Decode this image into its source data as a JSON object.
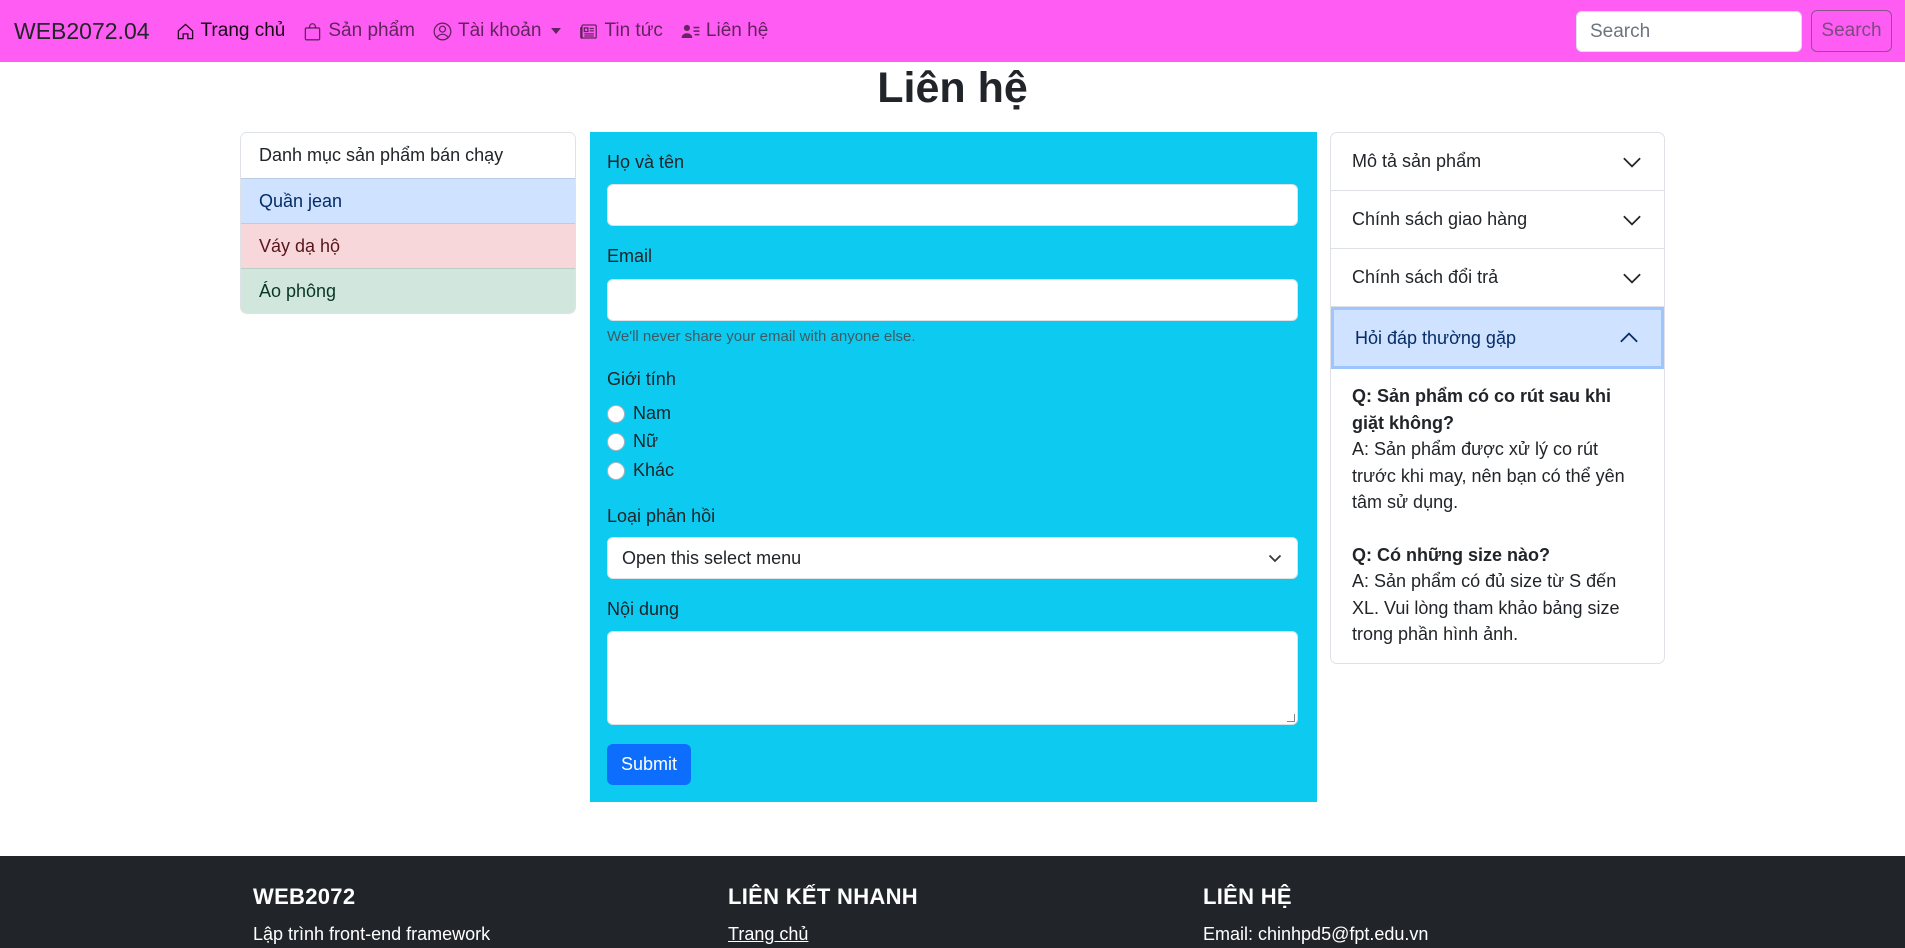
{
  "navbar": {
    "brand": "WEB2072.04",
    "items": [
      {
        "label": "Trang chủ",
        "icon": "house-icon"
      },
      {
        "label": "Sản phẩm",
        "icon": "bag-icon"
      },
      {
        "label": "Tài khoản",
        "icon": "person-circle-icon"
      },
      {
        "label": "Tin tức",
        "icon": "newspaper-icon"
      },
      {
        "label": "Liên hệ",
        "icon": "person-lines-icon"
      }
    ],
    "search_placeholder": "Search",
    "search_button": "Search"
  },
  "page": {
    "title": "Liên hệ"
  },
  "sidebar": {
    "items": [
      {
        "label": "Danh mục sản phẩm bán chạy"
      },
      {
        "label": "Quần jean"
      },
      {
        "label": "Váy dạ hộ"
      },
      {
        "label": "Áo phông"
      }
    ]
  },
  "form": {
    "name_label": "Họ và tên",
    "email_label": "Email",
    "email_help": "We'll never share your email with anyone else.",
    "gender_label": "Giới tính",
    "gender_options": [
      "Nam",
      "Nữ",
      "Khác"
    ],
    "feedback_label": "Loại phản hồi",
    "feedback_selected": "Open this select menu",
    "content_label": "Nội dung",
    "submit_label": "Submit"
  },
  "accordion": {
    "items": [
      {
        "title": "Mô tả sản phẩm"
      },
      {
        "title": "Chính sách giao hàng"
      },
      {
        "title": "Chính sách đổi trả"
      },
      {
        "title": "Hỏi đáp thường gặp"
      }
    ],
    "faq": [
      {
        "q": "Q: Sản phẩm có co rút sau khi giặt không?",
        "a": "A: Sản phẩm được xử lý co rút trước khi may, nên bạn có thể yên tâm sử dụng."
      },
      {
        "q": "Q: Có những size nào?",
        "a": "A: Sản phẩm có đủ size từ S đến XL. Vui lòng tham khảo bảng size trong phần hình ảnh."
      }
    ]
  },
  "footer": {
    "col1": {
      "title": "WEB2072",
      "text": "Lập trình front-end framework"
    },
    "col2": {
      "title": "LIÊN KẾT NHANH",
      "text": "Trang chủ"
    },
    "col3": {
      "title": "LIÊN HỆ",
      "text": "Email: chinhpd5@fpt.edu.vn"
    }
  },
  "colors": {
    "navbar_bg": "#ff5cf4",
    "form_bg": "#0dcaf0",
    "submit_bg": "#0d6efd",
    "footer_bg": "#212529"
  }
}
